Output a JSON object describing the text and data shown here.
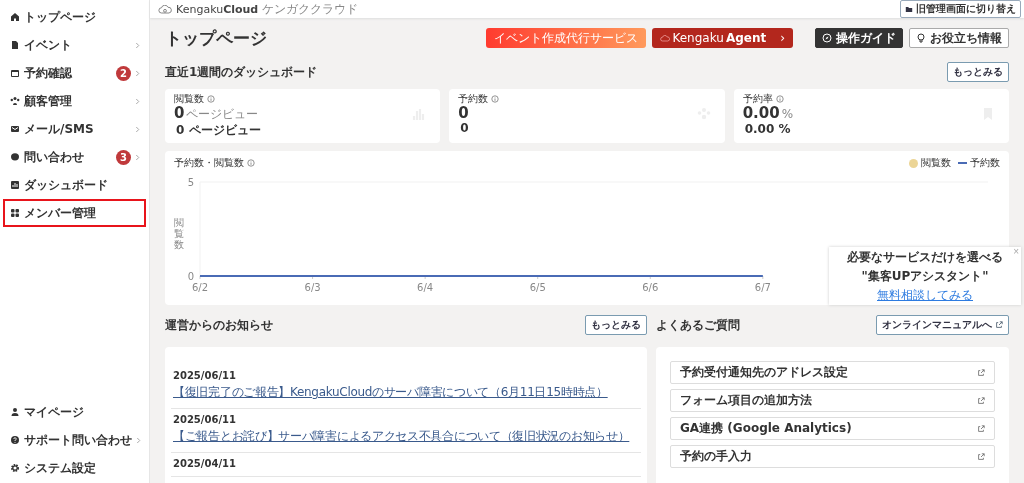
{
  "sidebar": {
    "items": [
      {
        "label": "トップページ",
        "has_submenu": false,
        "highlighted": false
      },
      {
        "label": "イベント",
        "has_submenu": true,
        "highlighted": false
      },
      {
        "label": "予約確認",
        "has_submenu": true,
        "badge": "2",
        "highlighted": false
      },
      {
        "label": "顧客管理",
        "has_submenu": true,
        "highlighted": false
      },
      {
        "label": "メール/SMS",
        "has_submenu": true,
        "highlighted": false
      },
      {
        "label": "問い合わせ",
        "has_submenu": true,
        "badge": "3",
        "highlighted": false
      },
      {
        "label": "ダッシュボード",
        "has_submenu": false,
        "highlighted": false
      },
      {
        "label": "メンバー管理",
        "has_submenu": false,
        "highlighted": true
      }
    ],
    "bottom_items": [
      {
        "label": "マイページ",
        "has_submenu": false
      },
      {
        "label": "サポート問い合わせ",
        "has_submenu": true
      },
      {
        "label": "システム設定",
        "has_submenu": false
      }
    ]
  },
  "header": {
    "logo_text": "Kengaku",
    "logo_bold": "Cloud",
    "logo_sub": "ケンガククラウド",
    "switch_button": "旧管理画面に切り替え"
  },
  "page_title": "トップページ",
  "promo_buttons": [
    {
      "label": "イベント作成代行サービス",
      "kind": "gradient"
    },
    {
      "label": "Kengaku",
      "label_bold": "Agent",
      "arrow": "›",
      "kind": "agent"
    }
  ],
  "tool_buttons": [
    {
      "label": "操作ガイド",
      "kind": "dark"
    },
    {
      "label": "お役立ち情報",
      "kind": "light"
    }
  ],
  "dashboard": {
    "heading": "直近1週間のダッシュボード",
    "more_button": "もっとみる",
    "stats": [
      {
        "label": "閲覧数",
        "value": "0",
        "unit": "ページビュー",
        "sub": "0 ページビュー"
      },
      {
        "label": "予約数",
        "value": "0",
        "sub": "0"
      },
      {
        "label": "予約率",
        "value": "0.00",
        "unit": "%",
        "sub": "0.00 %"
      }
    ],
    "chart": {
      "title": "予約数・閲覧数",
      "legend": [
        {
          "label": "閲覧数",
          "color": "#ecd596"
        }
      ],
      "chart_data": {
        "type": "line",
        "ylabel": "閲覧数",
        "categories": [
          "6/2",
          "6/3",
          "6/4",
          "6/5",
          "6/6",
          "6/7"
        ],
        "yticks": [
          0,
          5
        ],
        "ylim": [
          0,
          5
        ],
        "series": [
          {
            "name": "予約数",
            "color": "#4a6bb5",
            "values": [
              0,
              0,
              0,
              0,
              0,
              0
            ]
          }
        ]
      }
    }
  },
  "popup": {
    "line_1": "必要なサービスだけを選べる",
    "line_2": "\"集客UPアシスタント\"",
    "link": "無料相談してみる",
    "close": "×"
  },
  "notices": {
    "heading": "運営からのお知らせ",
    "more_button": "もっとみる",
    "items": [
      {
        "date": "2025/06/11",
        "title": "【復旧完了のご報告】KengakuCloudのサーバ障害について（6月11日15時時点）"
      },
      {
        "date": "2025/06/11",
        "title": "【ご報告とお詫び】サーバ障害によるアクセス不具合について（復旧状況のお知らせ）"
      },
      {
        "date": "2025/04/11"
      }
    ]
  },
  "faq": {
    "heading": "よくあるご質問",
    "manual_button": "オンラインマニュアルへ",
    "items": [
      "予約受付通知先のアドレス設定",
      "フォーム項目の追加方法",
      "GA連携 (Google Analytics)",
      "予約の手入力"
    ]
  }
}
